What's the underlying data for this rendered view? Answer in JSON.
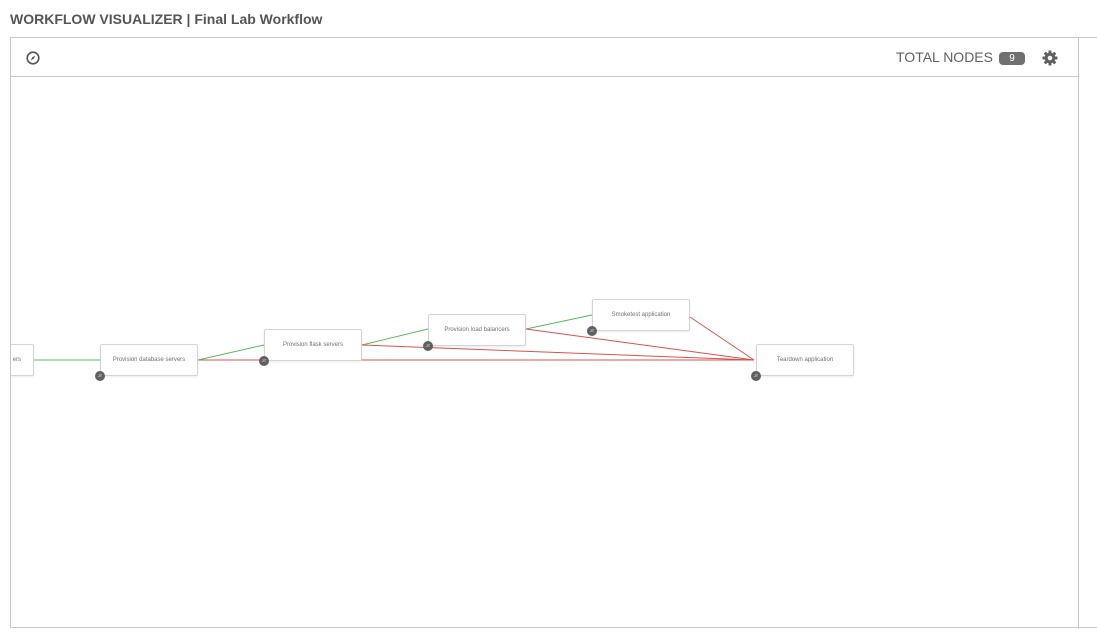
{
  "header": {
    "title": "WORKFLOW VISUALIZER | Final Lab Workflow"
  },
  "toolbar": {
    "compass_icon": "compass-icon",
    "total_nodes_label": "TOTAL NODES",
    "total_nodes_count": "9",
    "settings_icon": "gear-icon"
  },
  "workflow": {
    "nodes": [
      {
        "id": "n0",
        "label": "ers",
        "badge": ""
      },
      {
        "id": "n1",
        "label": "Provision database servers",
        "badge": "JT"
      },
      {
        "id": "n2",
        "label": "Provision flask servers",
        "badge": "JT"
      },
      {
        "id": "n3",
        "label": "Provision load balancers",
        "badge": "JT"
      },
      {
        "id": "n4",
        "label": "Smoketest application",
        "badge": "JT"
      },
      {
        "id": "n5",
        "label": "Teardown application",
        "badge": "JT"
      }
    ],
    "link_colors": {
      "success": "#5cb85c",
      "failure": "#d9534f"
    }
  }
}
